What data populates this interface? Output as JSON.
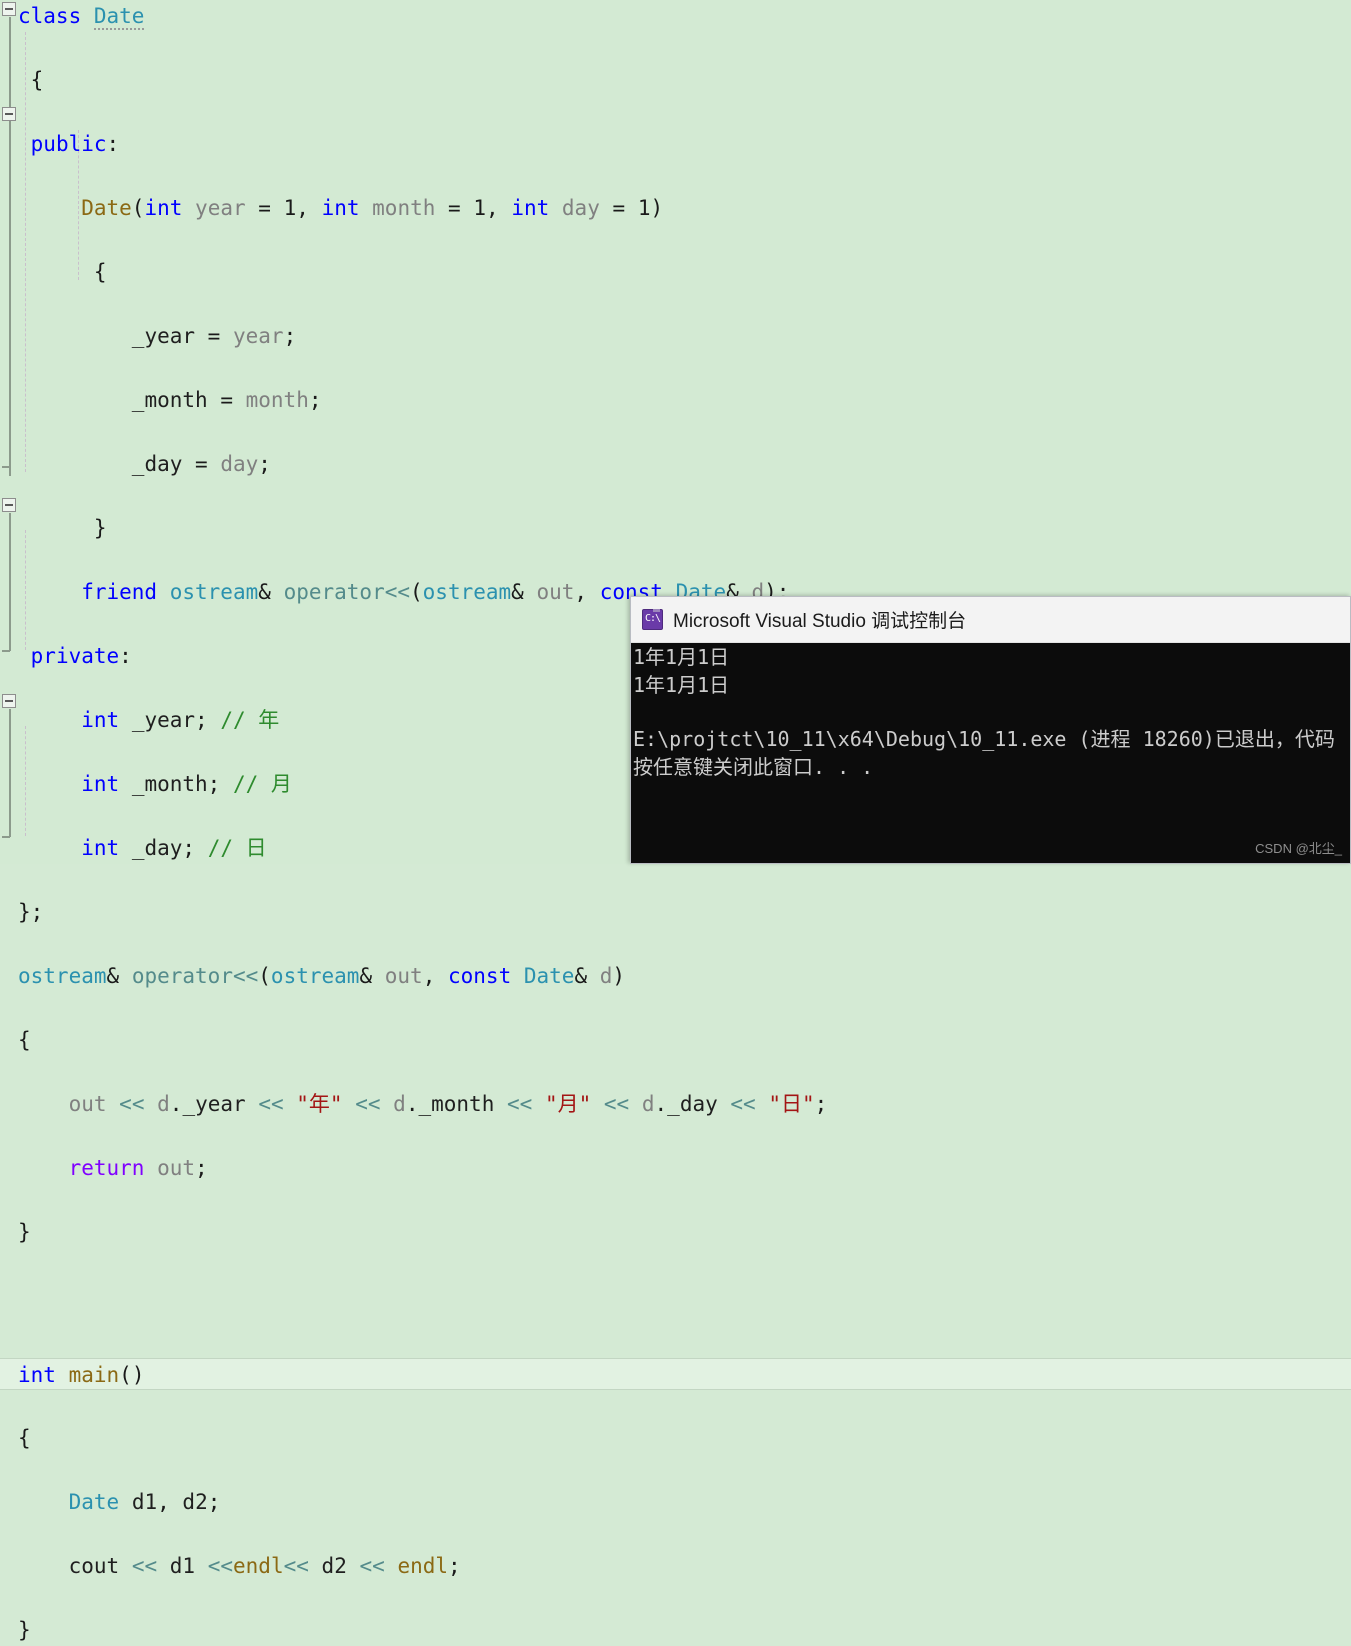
{
  "editor": {
    "background_color": "#d3ead3",
    "current_line_color": "#e2f2e2",
    "lines": [
      {
        "indent": 0,
        "text": "class Date"
      },
      {
        "indent": 0,
        "text": "{"
      },
      {
        "indent": 0,
        "text": "public:"
      },
      {
        "indent": 1,
        "text": "Date(int year = 1, int month = 1, int day = 1)"
      },
      {
        "indent": 1,
        "text": "{"
      },
      {
        "indent": 2,
        "text": "_year = year;"
      },
      {
        "indent": 2,
        "text": "_month = month;"
      },
      {
        "indent": 2,
        "text": "_day = day;"
      },
      {
        "indent": 1,
        "text": "}"
      },
      {
        "indent": 1,
        "text": "friend ostream& operator<<(ostream& out, const Date& d);"
      },
      {
        "indent": 0,
        "text": "private:"
      },
      {
        "indent": 1,
        "text": "int _year; // 年"
      },
      {
        "indent": 1,
        "text": "int _month; // 月"
      },
      {
        "indent": 1,
        "text": "int _day; // 日"
      },
      {
        "indent": 0,
        "text": "};"
      },
      {
        "indent": 0,
        "text": "ostream& operator<<(ostream& out, const Date& d)"
      },
      {
        "indent": 0,
        "text": "{"
      },
      {
        "indent": 1,
        "text": "out << d._year << \"年\" << d._month << \"月\" << d._day << \"日\";"
      },
      {
        "indent": 1,
        "text": "return out;"
      },
      {
        "indent": 0,
        "text": "}"
      },
      {
        "indent": 0,
        "text": ""
      },
      {
        "indent": 0,
        "text": "int main()"
      },
      {
        "indent": 0,
        "text": "{"
      },
      {
        "indent": 1,
        "text": "Date d1, d2;"
      },
      {
        "indent": 1,
        "text": "cout << d1 <<endl<< d2 << endl;"
      },
      {
        "indent": 0,
        "text": "}"
      }
    ],
    "current_line_text": "int main()",
    "outline_markers": [
      "collapse-class-date",
      "collapse-date-ctor",
      "collapse-operator-overload",
      "collapse-main"
    ]
  },
  "console": {
    "title": "Microsoft Visual Studio 调试控制台",
    "icon": "command-prompt-icon",
    "icon_glyph": "C:\\",
    "background_color": "#0c0c0c",
    "text_color": "#cccccc",
    "titlebar_color": "#f3f3f3",
    "lines": [
      "1年1月1日",
      "1年1月1日",
      "",
      "E:\\projtct\\10_11\\x64\\Debug\\10_11.exe (进程 18260)已退出，代码",
      "按任意键关闭此窗口. . ."
    ]
  },
  "watermark": {
    "text": "CSDN @北尘_"
  }
}
